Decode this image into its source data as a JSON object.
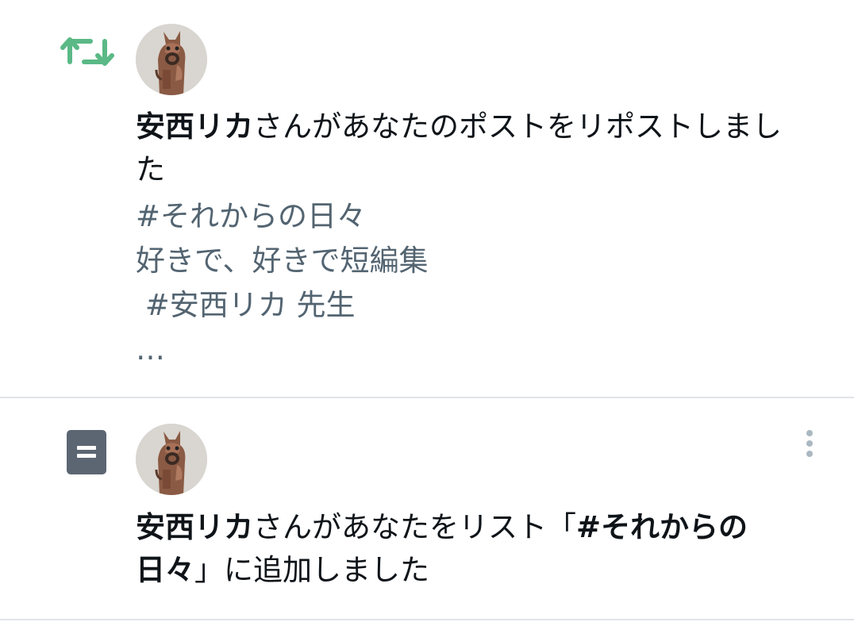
{
  "notifications": [
    {
      "type": "repost",
      "icon": "retweet-icon",
      "icon_color": "#5ab986",
      "actor": "安西リカ",
      "action_text": "さんがあなたのポストをリポストしました",
      "post_preview": [
        "#それからの日々",
        "好きで、好きで短編集",
        " #安西リカ 先生",
        "…"
      ]
    },
    {
      "type": "list_add",
      "icon": "list-icon",
      "icon_color": "#5b6672",
      "actor": "安西リカ",
      "action_text_before": "さんがあなたをリスト「",
      "list_name": "#それからの日々",
      "action_text_after": "」に追加しました",
      "more_icon": "more-vertical-icon"
    }
  ]
}
